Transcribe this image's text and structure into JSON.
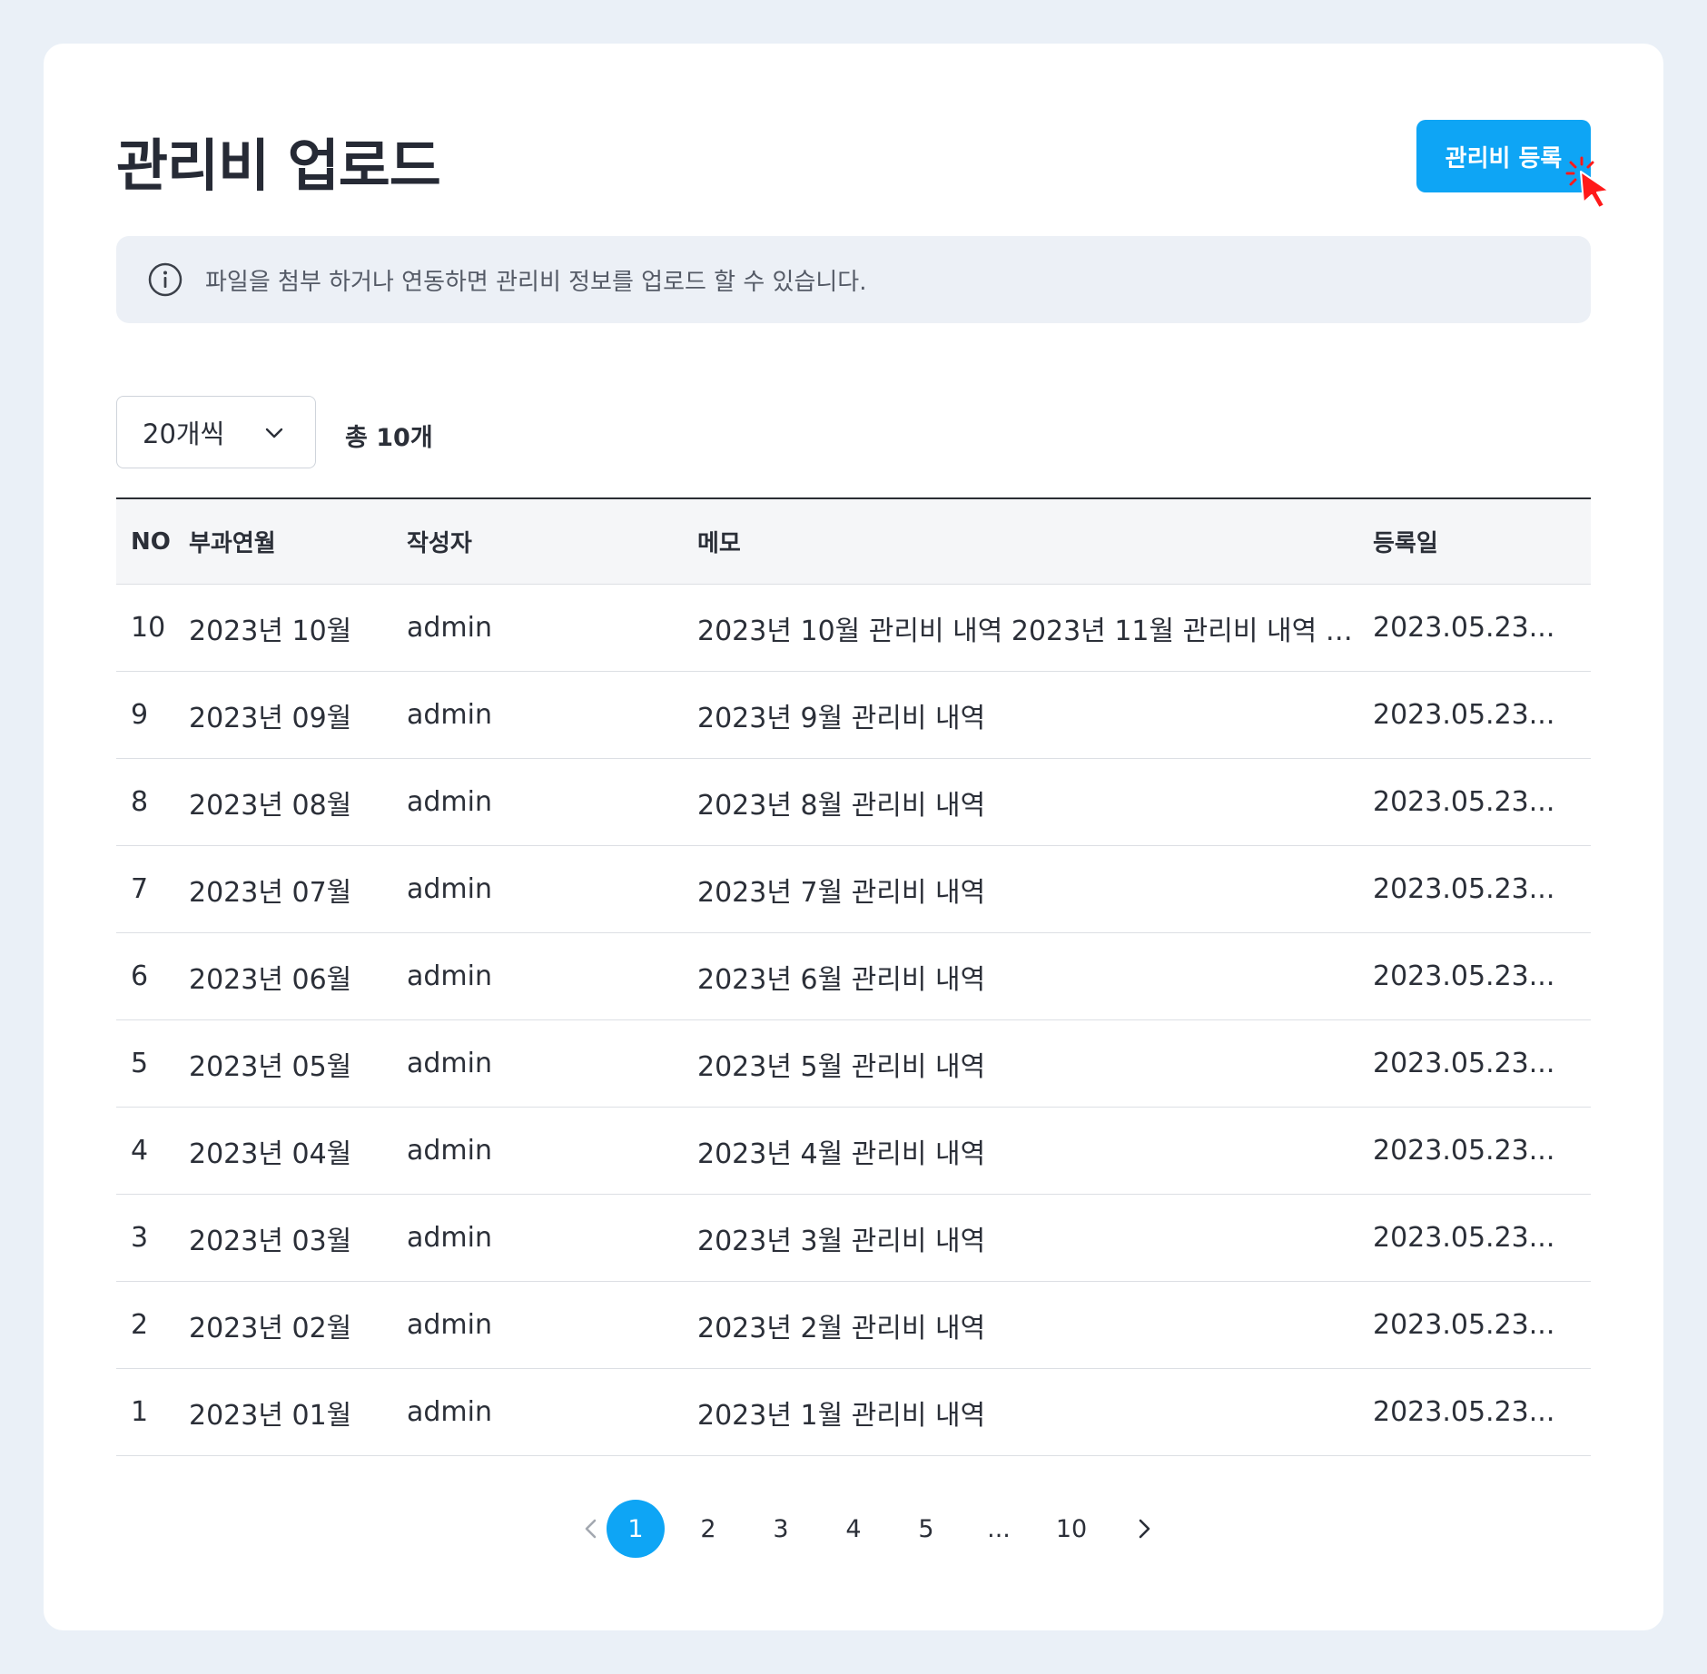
{
  "page": {
    "title": "관리비 업로드",
    "register_button": "관리비 등록",
    "info_text": "파일을 첨부 하거나 연동하면 관리비 정보를 업로드 할 수 있습니다."
  },
  "controls": {
    "page_size": "20개씩",
    "total_count": "총 10개"
  },
  "table": {
    "headers": {
      "no": "NO",
      "month": "부과연월",
      "author": "작성자",
      "memo": "메모",
      "date": "등록일"
    },
    "rows": [
      {
        "no": "10",
        "month": "2023년 10월",
        "author": "admin",
        "memo": "2023년 10월 관리비 내역 2023년 11월 관리비 내역 2...",
        "date": "2023.05.23..."
      },
      {
        "no": "9",
        "month": "2023년 09월",
        "author": "admin",
        "memo": "2023년 9월 관리비 내역",
        "date": "2023.05.23..."
      },
      {
        "no": "8",
        "month": "2023년 08월",
        "author": "admin",
        "memo": "2023년 8월 관리비 내역",
        "date": "2023.05.23..."
      },
      {
        "no": "7",
        "month": "2023년 07월",
        "author": "admin",
        "memo": "2023년 7월 관리비 내역",
        "date": "2023.05.23..."
      },
      {
        "no": "6",
        "month": "2023년 06월",
        "author": "admin",
        "memo": "2023년 6월 관리비 내역",
        "date": "2023.05.23..."
      },
      {
        "no": "5",
        "month": "2023년 05월",
        "author": "admin",
        "memo": "2023년 5월 관리비 내역",
        "date": "2023.05.23..."
      },
      {
        "no": "4",
        "month": "2023년 04월",
        "author": "admin",
        "memo": "2023년 4월 관리비 내역",
        "date": "2023.05.23..."
      },
      {
        "no": "3",
        "month": "2023년 03월",
        "author": "admin",
        "memo": "2023년 3월 관리비 내역",
        "date": "2023.05.23..."
      },
      {
        "no": "2",
        "month": "2023년 02월",
        "author": "admin",
        "memo": "2023년 2월 관리비 내역",
        "date": "2023.05.23..."
      },
      {
        "no": "1",
        "month": "2023년 01월",
        "author": "admin",
        "memo": "2023년 1월 관리비 내역",
        "date": "2023.05.23..."
      }
    ]
  },
  "pagination": {
    "pages": [
      "1",
      "2",
      "3",
      "4",
      "5",
      "...",
      "10"
    ],
    "current": "1"
  },
  "colors": {
    "accent": "#0ea5f5",
    "background": "#eaf0f7",
    "cursor": "#ff1a1a"
  },
  "icons": {
    "info": "info-circle-icon",
    "select": "chevron-down-icon",
    "prev": "chevron-left-icon",
    "next": "chevron-right-icon",
    "cursor": "click-cursor-icon"
  }
}
